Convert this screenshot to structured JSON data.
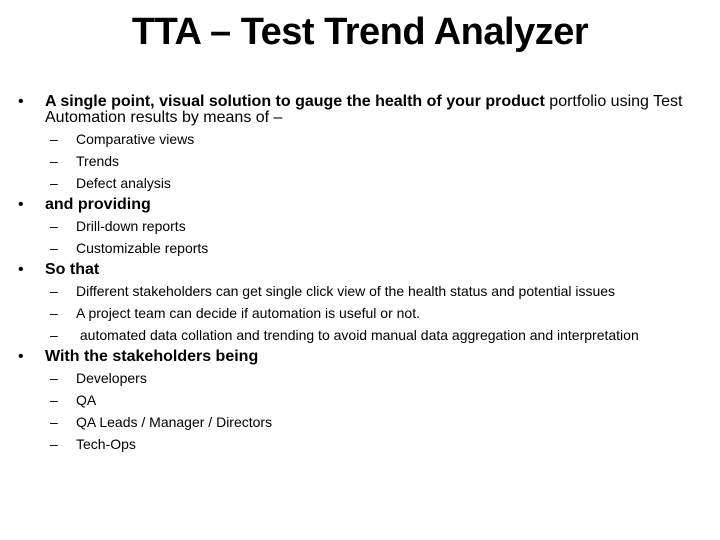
{
  "slide": {
    "title": "TTA – Test Trend Analyzer",
    "bullet_glyph": "•",
    "dash_glyph": "–",
    "items": [
      {
        "bold": "A single point, visual solution to gauge the health of your product",
        "rest": " portfolio using Test Automation results  by means of –",
        "subitems": [
          "Comparative views",
          "Trends",
          "Defect analysis"
        ]
      },
      {
        "bold": "and providing",
        "rest": "",
        "subitems": [
          "Drill-down reports",
          "Customizable reports"
        ]
      },
      {
        "bold": "So that",
        "rest": "",
        "subitems": [
          "Different stakeholders can get single click view of the health status and potential issues",
          "A project team can decide if automation is useful or not.",
          " automated data collation and trending to avoid manual data aggregation and interpretation"
        ]
      },
      {
        "bold": "With the stakeholders being",
        "rest": "",
        "subitems": [
          "Developers",
          "QA",
          "QA Leads / Manager / Directors",
          "Tech-Ops"
        ]
      }
    ]
  }
}
